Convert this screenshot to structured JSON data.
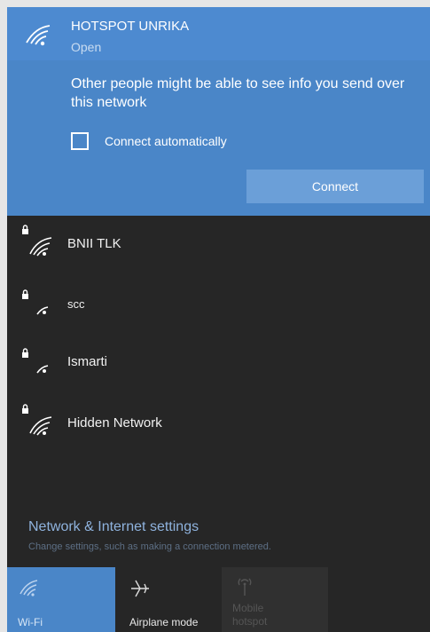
{
  "selected_network": {
    "name": "HOTSPOT UNRIKA",
    "status": "Open",
    "warning": "Other people might be able to see info you send over this network",
    "connect_automatically_label": "Connect automatically",
    "connect_automatically_checked": false,
    "connect_button_label": "Connect",
    "icon": "wifi-icon"
  },
  "networks": [
    {
      "name": "BNII TLK",
      "secured": true,
      "signal": "full"
    },
    {
      "name": "scc",
      "secured": true,
      "signal": "low"
    },
    {
      "name": "Ismarti",
      "secured": true,
      "signal": "low"
    },
    {
      "name": "Hidden Network",
      "secured": true,
      "signal": "full"
    }
  ],
  "settings": {
    "title": "Network & Internet settings",
    "subtitle": "Change settings, such as making a connection metered."
  },
  "quick_actions": [
    {
      "label": "Wi-Fi",
      "icon": "wifi-icon",
      "active": true
    },
    {
      "label": "Airplane mode",
      "icon": "airplane-icon",
      "active": false
    },
    {
      "label": "Mobile hotspot",
      "icon": "hotspot-icon",
      "active": false,
      "disabled": true
    }
  ],
  "colors": {
    "accent": "#4a86c8",
    "panel_background": "#262626"
  }
}
